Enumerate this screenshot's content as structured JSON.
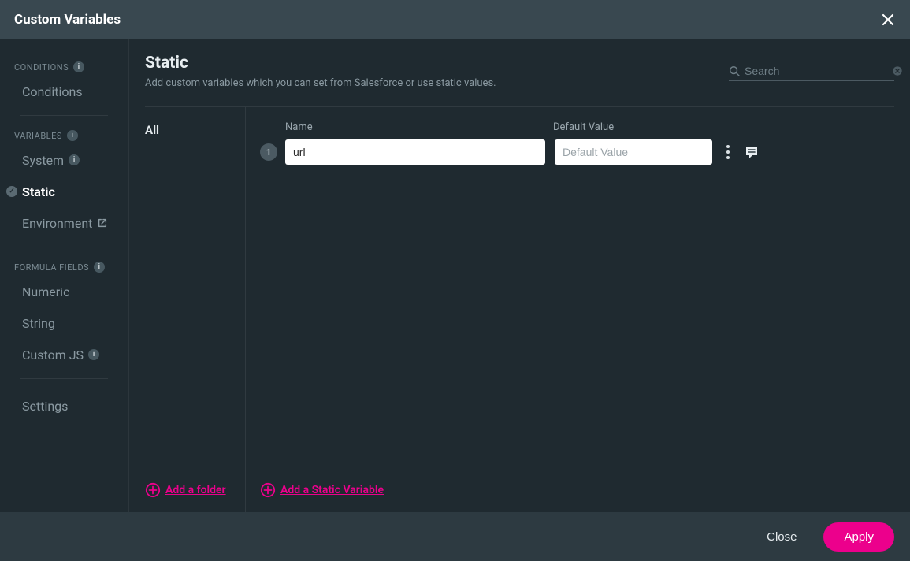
{
  "title": "Custom Variables",
  "sidebar": {
    "sections": [
      {
        "header": "CONDITIONS",
        "info": true,
        "items": [
          {
            "label": "Conditions",
            "selected": false,
            "check": false,
            "info": false,
            "external": false
          }
        ]
      },
      {
        "header": "VARIABLES",
        "info": true,
        "items": [
          {
            "label": "System",
            "selected": false,
            "check": false,
            "info": true,
            "external": false
          },
          {
            "label": "Static",
            "selected": true,
            "check": true,
            "info": false,
            "external": false
          },
          {
            "label": "Environment",
            "selected": false,
            "check": false,
            "info": false,
            "external": true
          }
        ]
      },
      {
        "header": "FORMULA FIELDS",
        "info": true,
        "items": [
          {
            "label": "Numeric",
            "selected": false,
            "check": false,
            "info": false,
            "external": false
          },
          {
            "label": "String",
            "selected": false,
            "check": false,
            "info": false,
            "external": false
          },
          {
            "label": "Custom JS",
            "selected": false,
            "check": false,
            "info": true,
            "external": false
          }
        ]
      },
      {
        "header": "",
        "info": false,
        "items": [
          {
            "label": "Settings",
            "selected": false,
            "check": false,
            "info": false,
            "external": false
          }
        ]
      }
    ]
  },
  "main": {
    "heading": "Static",
    "subheading": "Add custom variables which you can set from Salesforce or use static values.",
    "search_placeholder": "Search",
    "folder_label": "All",
    "add_folder": "Add a folder",
    "add_variable": "Add a Static Variable",
    "name_label": "Name",
    "default_label": "Default Value",
    "default_placeholder": "Default Value",
    "rows": [
      {
        "index": "1",
        "name": "url",
        "default": ""
      }
    ]
  },
  "footer": {
    "close": "Close",
    "apply": "Apply"
  }
}
